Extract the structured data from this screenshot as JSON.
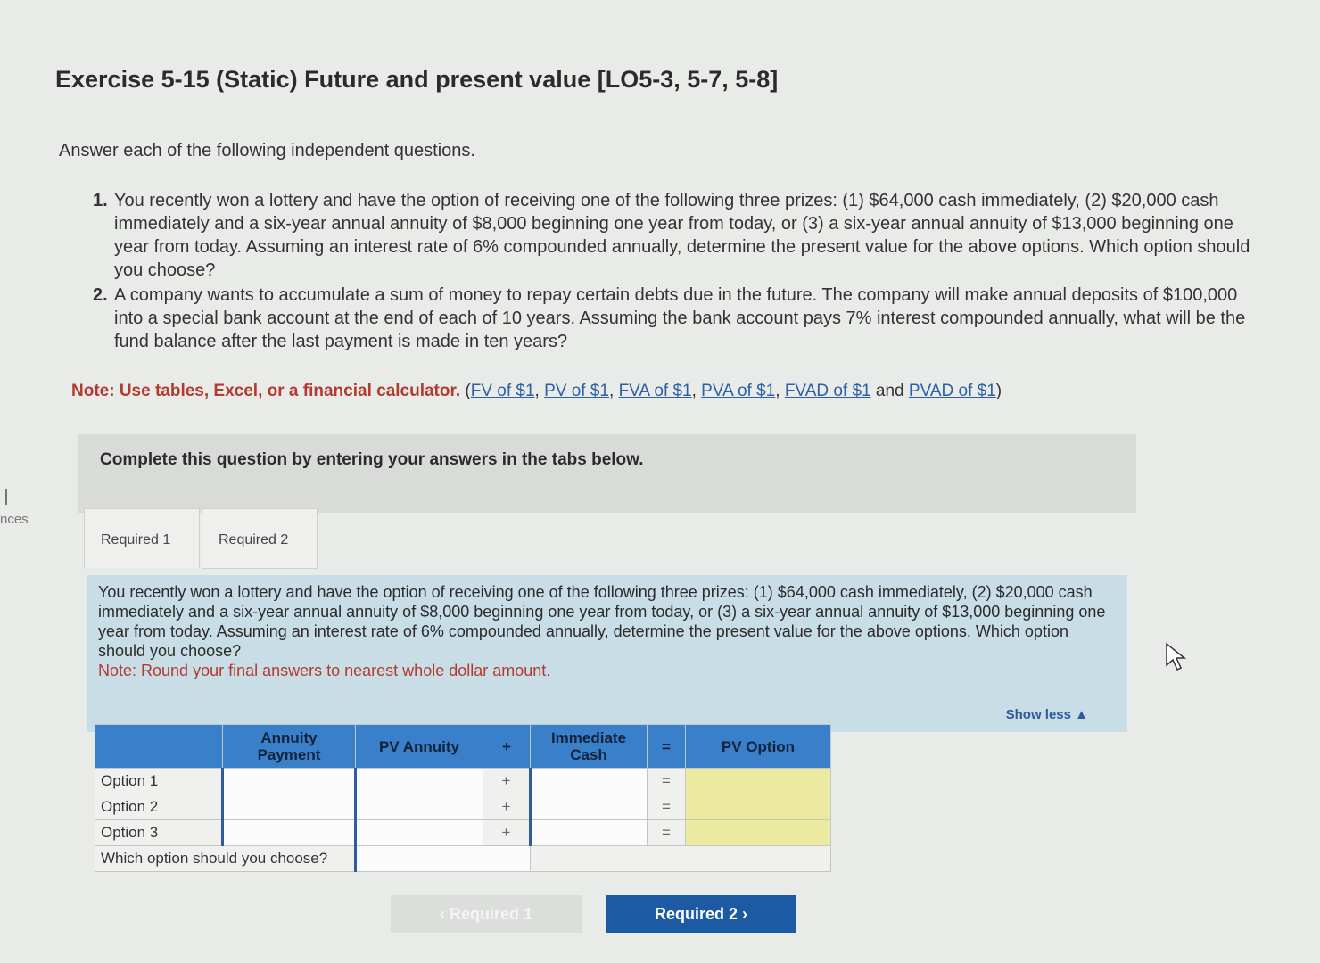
{
  "side": {
    "label": "nces"
  },
  "exercise": {
    "title": "Exercise 5-15 (Static) Future and present value [LO5-3, 5-7, 5-8]",
    "intro": "Answer each of the following independent questions.",
    "questions": [
      {
        "num": "1.",
        "text": "You recently won a lottery and have the option of receiving one of the following three prizes: (1) $64,000 cash immediately, (2) $20,000 cash immediately and a six-year annual annuity of $8,000 beginning one year from today, or (3) a six-year annual annuity of $13,000 beginning one year from today. Assuming an interest rate of 6% compounded annually, determine the present value for the above options. Which option should you choose?"
      },
      {
        "num": "2.",
        "text": "A company wants to accumulate a sum of money to repay certain debts due in the future. The company will make annual deposits of $100,000 into a special bank account at the end of each of 10 years. Assuming the bank account pays 7% interest compounded annually, what will be the fund balance after the last payment is made in ten years?"
      }
    ],
    "note_label": "Note: Use tables, Excel, or a financial calculator.",
    "note_links": {
      "open": "(",
      "fv": "FV of $1",
      "pv": "PV of $1",
      "fva": "FVA of $1",
      "pva": "PVA of $1",
      "fvad": "FVAD of $1",
      "and": "and",
      "pvad": "PVAD of $1",
      "close": ")"
    }
  },
  "complete_box": {
    "text": "Complete this question by entering your answers in the tabs below."
  },
  "tabs": [
    {
      "label": "Required 1"
    },
    {
      "label": "Required 2"
    }
  ],
  "panel": {
    "question": "You recently won a lottery and have the option of receiving one of the following three prizes: (1) $64,000 cash immediately, (2) $20,000 cash immediately and a six-year annual annuity of $8,000 beginning one year from today, or (3) a six-year annual annuity of $13,000 beginning one year from today. Assuming an interest rate of 6% compounded annually, determine the present value for the above options. Which option should you choose?",
    "note": "Note: Round your final answers to nearest whole dollar amount.",
    "show_less": "Show less ▲"
  },
  "table": {
    "headers": {
      "annuity_payment": "Annuity Payment",
      "pv_annuity": "PV Annuity",
      "plus": "+",
      "immediate_cash": "Immediate Cash",
      "equals": "=",
      "pv_option": "PV Option"
    },
    "rows": [
      {
        "label": "Option 1",
        "plus": "+",
        "equals": "="
      },
      {
        "label": "Option 2",
        "plus": "+",
        "equals": "="
      },
      {
        "label": "Option 3",
        "plus": "+",
        "equals": "="
      }
    ],
    "choose_label": "Which option should you choose?"
  },
  "nav": {
    "prev": "‹ Required 1",
    "next": "Required 2  ›"
  }
}
